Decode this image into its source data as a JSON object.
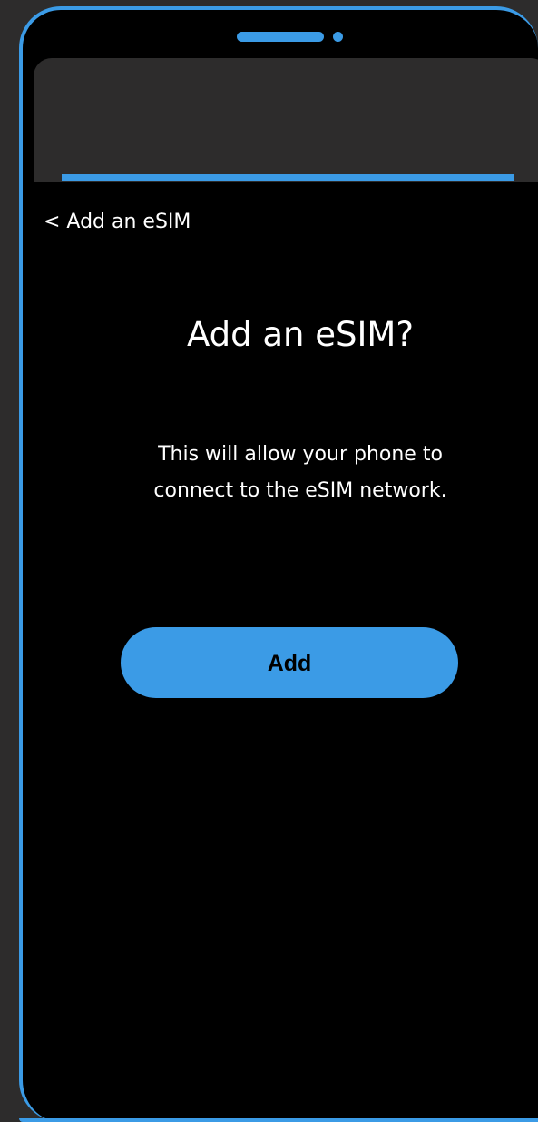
{
  "screen": {
    "back_link": "< Add an eSIM",
    "title": "Add an eSIM?",
    "description_lines": [
      "This will allow your phone to",
      "connect to the eSIM network."
    ],
    "add_button": "Add"
  },
  "colors": {
    "accent": "#3b9be6",
    "background": "#2d2c2c",
    "screen": "#000000",
    "text": "#ffffff"
  }
}
